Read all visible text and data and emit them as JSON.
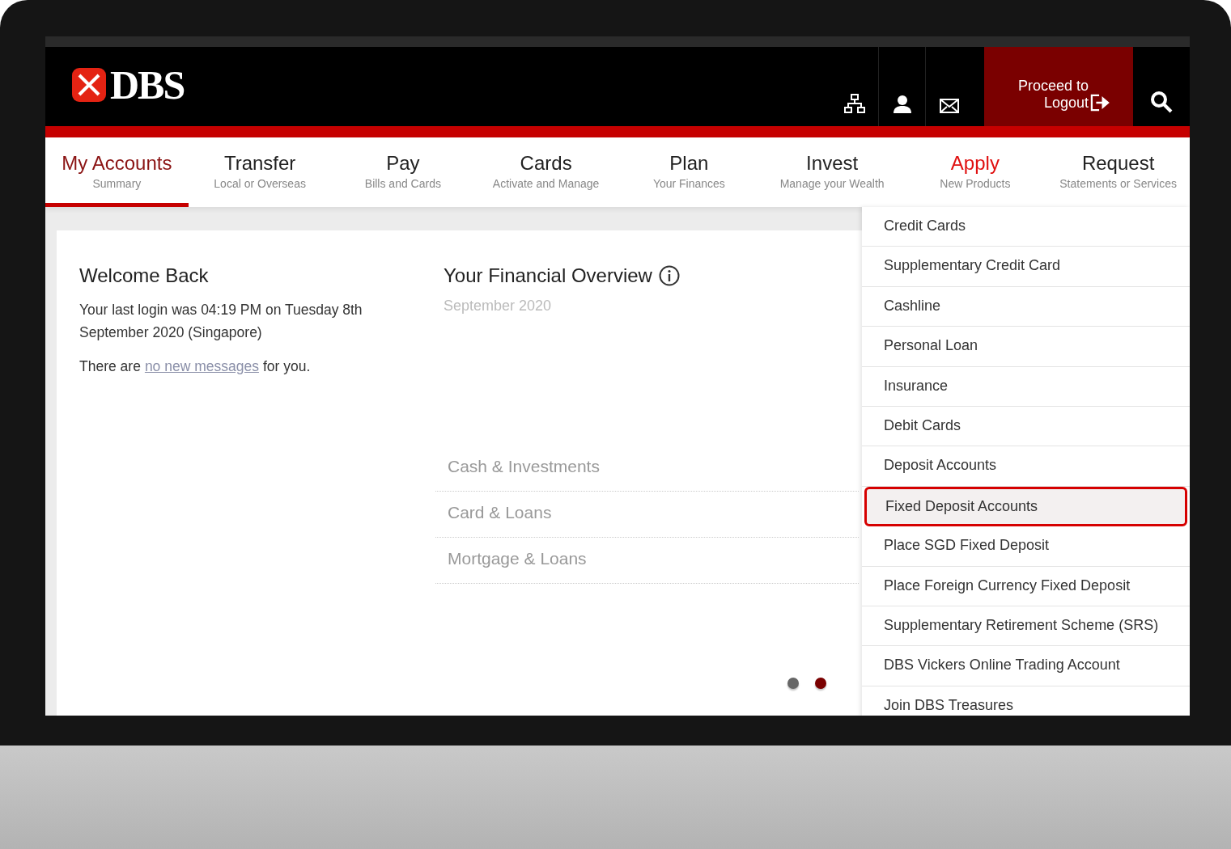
{
  "header": {
    "logo_text": "DBS",
    "logout_label": "Proceed to Logout"
  },
  "nav_tabs": [
    {
      "label": "My Accounts",
      "sub": "Summary",
      "selected": true,
      "open": false
    },
    {
      "label": "Transfer",
      "sub": "Local or Overseas",
      "selected": false,
      "open": false
    },
    {
      "label": "Pay",
      "sub": "Bills and Cards",
      "selected": false,
      "open": false
    },
    {
      "label": "Cards",
      "sub": "Activate and Manage",
      "selected": false,
      "open": false
    },
    {
      "label": "Plan",
      "sub": "Your Finances",
      "selected": false,
      "open": false
    },
    {
      "label": "Invest",
      "sub": "Manage your Wealth",
      "selected": false,
      "open": false
    },
    {
      "label": "Apply",
      "sub": "New Products",
      "selected": false,
      "open": true
    },
    {
      "label": "Request",
      "sub": "Statements or Services",
      "selected": false,
      "open": false
    }
  ],
  "welcome": {
    "title": "Welcome Back",
    "login_text": "Your last login was 04:19 PM on Tuesday 8th September 2020 (Singapore)",
    "messages_before": "There are",
    "messages_link": "no new messages",
    "messages_after": "for you."
  },
  "overview": {
    "title": "Your Financial Overview",
    "date": "September 2020",
    "categories": [
      "Cash & Investments",
      "Card & Loans",
      "Mortgage & Loans"
    ],
    "pager": [
      {
        "selected": false
      },
      {
        "selected": true
      }
    ]
  },
  "apply_menu": [
    {
      "label": "Credit Cards",
      "selected": false
    },
    {
      "label": "Supplementary Credit Card",
      "selected": false
    },
    {
      "label": "Cashline",
      "selected": false
    },
    {
      "label": "Personal Loan",
      "selected": false
    },
    {
      "label": "Insurance",
      "selected": false
    },
    {
      "label": "Debit Cards",
      "selected": false
    },
    {
      "label": "Deposit Accounts",
      "selected": false
    },
    {
      "label": "Fixed Deposit Accounts",
      "selected": true
    },
    {
      "label": "Place SGD Fixed Deposit",
      "selected": false
    },
    {
      "label": "Place Foreign Currency Fixed Deposit",
      "selected": false
    },
    {
      "label": "Supplementary Retirement Scheme (SRS)",
      "selected": false
    },
    {
      "label": "DBS Vickers Online Trading Account",
      "selected": false
    },
    {
      "label": "Join DBS Treasures",
      "selected": false
    }
  ]
}
